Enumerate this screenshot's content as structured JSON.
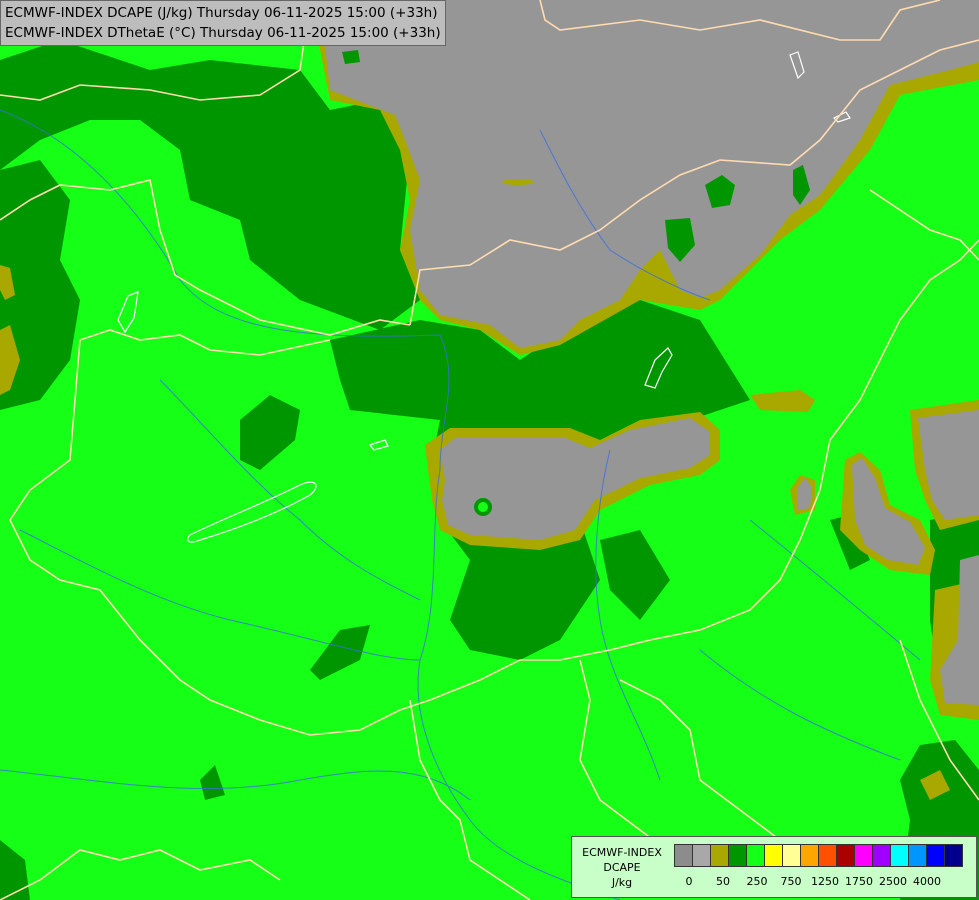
{
  "header": {
    "line1": "ECMWF-INDEX DCAPE (J/kg) Thursday 06-11-2025 15:00 (+33h)",
    "line2": "ECMWF-INDEX DThetaE (°C) Thursday 06-11-2025 15:00 (+33h)"
  },
  "legend": {
    "title_line1": "ECMWF-INDEX",
    "title_line2": "DCAPE",
    "unit": "J/kg",
    "swatch_colors": [
      "#8c8c8c",
      "#a8a8a8",
      "#a8a800",
      "#009600",
      "#16ff16",
      "#ffff00",
      "#ffff96",
      "#ffa500",
      "#ff5000",
      "#aa0000",
      "#ff00ff",
      "#a000ff",
      "#00ffff",
      "#0096ff",
      "#0000ff",
      "#00008c"
    ],
    "tick_labels": [
      "0",
      "50",
      "250",
      "750",
      "1250",
      "1750",
      "2500",
      "4000"
    ]
  },
  "colors": {
    "gray": "#969696",
    "olive": "#a8a800",
    "dark_green": "#009600",
    "bright_green": "#16ff16",
    "border": "#ffddaa",
    "river": "#3a6ee0"
  }
}
